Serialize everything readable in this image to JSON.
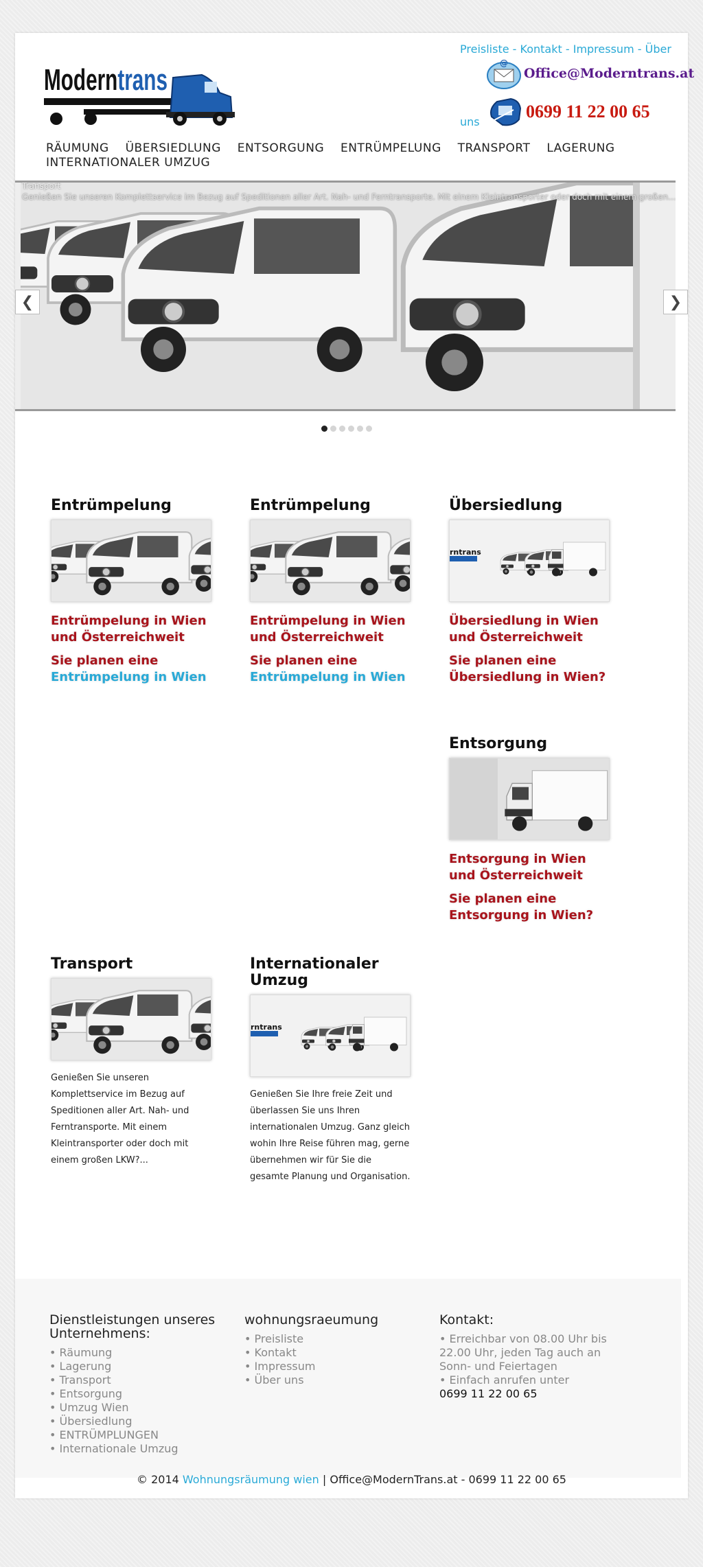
{
  "header": {
    "logo_text": "Moderntrans",
    "top_links": [
      "Preisliste",
      "Kontakt",
      "Impressum",
      "Über uns"
    ],
    "link_separator": " - ",
    "email_badge": "Office@Moderntrans.at",
    "phone_badge": "0699 11 22 00 65"
  },
  "nav": [
    "RÄUMUNG",
    "ÜBERSIEDLUNG",
    "ENTSORGUNG",
    "ENTRÜMPELUNG",
    "TRANSPORT",
    "LAGERUNG",
    "INTERNATIONALER UMZUG"
  ],
  "slider": {
    "caption_title": "Transport",
    "caption_text": "Genießen Sie unseren Komplettservice im Bezug auf Speditionen aller Art. Nah- und Ferntransporte. Mit einem Kleintransporter oder doch mit einem großen...",
    "prev_icon": "chevron-left-icon",
    "next_icon": "chevron-right-icon",
    "dots": 6,
    "active_dot": 0
  },
  "cards": [
    {
      "title": "Entrümpelung",
      "heading": "Entrümpelung  in Wien und Österreichweit",
      "sub_plain": "Sie planen eine ",
      "sub_link": "Entrümpelung in Wien"
    },
    {
      "title": "Entrümpelung",
      "heading": "Entrümpelung  in Wien und Österreichweit",
      "sub_plain": "Sie planen eine ",
      "sub_link": "Entrümpelung in Wien"
    },
    {
      "title": "Übersiedlung",
      "heading": "Übersiedlung in Wien und Österreichweit",
      "sub_plain": "Sie planen eine Übersiedlung in Wien?",
      "sub_link": ""
    },
    {
      "title": "Entsorgung",
      "heading": "Entsorgung in Wien und Österreichweit",
      "sub_plain": "Sie planen eine Entsorgung in Wien?",
      "sub_link": ""
    },
    {
      "title": "Transport",
      "desc": "Genießen Sie unseren Komplettservice im Bezug auf Speditionen aller Art. Nah- und Ferntransporte. Mit einem Kleintransporter oder doch mit einem großen LKW?..."
    },
    {
      "title": "Internationaler Umzug",
      "desc": "Genießen Sie Ihre freie Zeit und überlassen Sie uns Ihren internationalen Umzug. Ganz gleich wohin Ihre Reise führen mag, gerne übernehmen wir für Sie die gesamte Planung und Organisation."
    }
  ],
  "footer": {
    "col1": {
      "title": "Dienstleistungen unseres Unternehmens:",
      "items": [
        "Räumung",
        "Lagerung",
        "Transport",
        "Entsorgung",
        "Umzug Wien",
        "Übersiedlung",
        "ENTRÜMPLUNGEN",
        "Internationale Umzug"
      ]
    },
    "col2": {
      "title": "wohnungsraeumung",
      "items": [
        "Preisliste",
        "Kontakt",
        "Impressum",
        "Über uns"
      ]
    },
    "col3": {
      "title": "Kontakt:",
      "items": [
        "Erreichbar von 08.00 Uhr bis 22.00 Uhr, jeden Tag auch an Sonn- und Feiertagen",
        "Einfach anrufen unter"
      ],
      "phone": "0699 11 22 00 65"
    },
    "copyright_prefix": "© 2014 ",
    "copyright_link": "Wohnungsräumung wien",
    "copyright_suffix": " | Office@ModernTrans.at - 0699 11 22 00 65"
  },
  "colors": {
    "accent": "#29a9d6",
    "headline_red": "#a8141c",
    "logo_blue": "#1f5fb0"
  }
}
